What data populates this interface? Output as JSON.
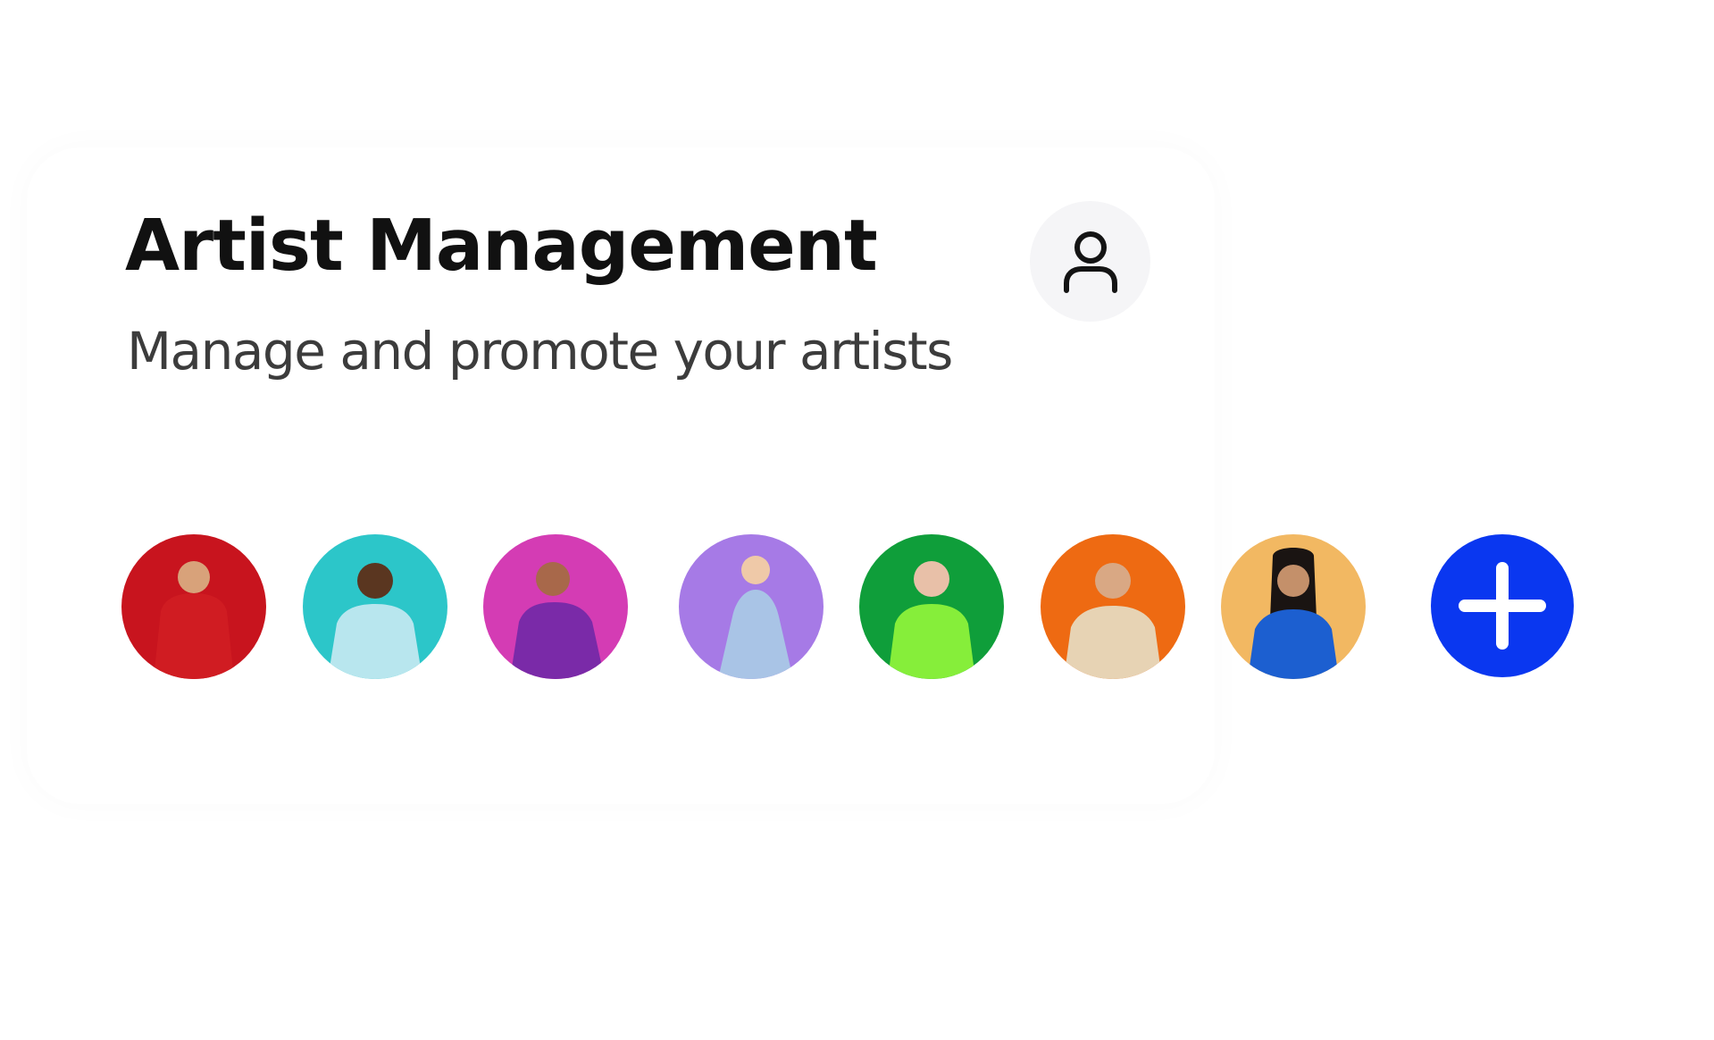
{
  "header": {
    "title": "Artist Management",
    "subtitle": "Manage and promote your artists"
  },
  "profile_button": {
    "icon": "user-icon"
  },
  "artists": [
    {
      "icon": "artist-photo",
      "background": "#c8141e",
      "outfit": "#d01c22"
    },
    {
      "icon": "artist-photo",
      "background": "#2cc6c9",
      "outfit": "#b8e6ee"
    },
    {
      "icon": "artist-photo",
      "background": "#d43cb4",
      "outfit": "#7a2aa8"
    },
    {
      "icon": "artist-photo",
      "background": "#a67ae6",
      "outfit": "#a9c4e6"
    },
    {
      "icon": "artist-photo",
      "background": "#0f9e3a",
      "outfit": "#86ee3a"
    },
    {
      "icon": "artist-photo",
      "background": "#ee6a12",
      "outfit": "#e7d3b4"
    },
    {
      "icon": "artist-photo",
      "background": "#f2b862",
      "outfit": "#1c5fd0"
    }
  ],
  "add_button": {
    "icon": "plus-icon",
    "color": "#0a37f0"
  }
}
